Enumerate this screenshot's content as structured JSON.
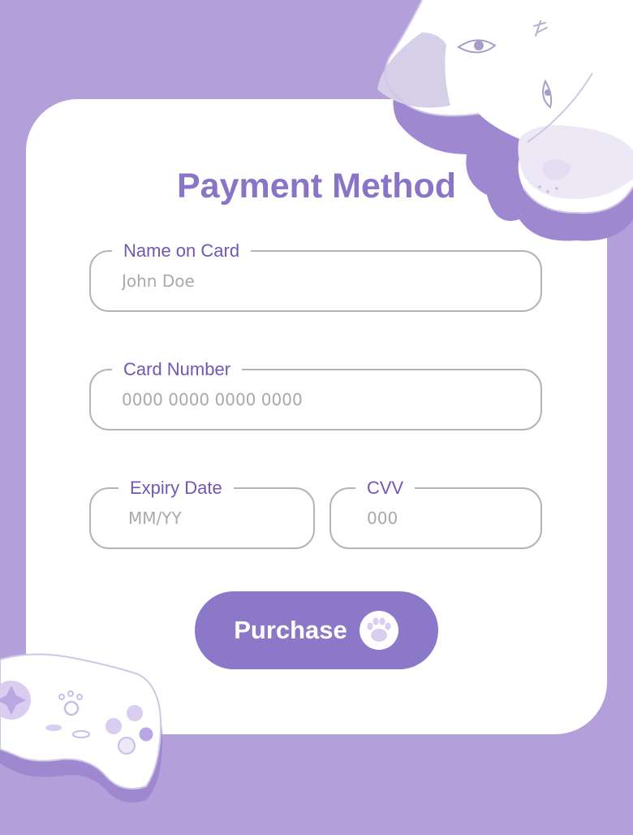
{
  "form": {
    "title": "Payment Method",
    "name_field": {
      "label": "Name on Card",
      "placeholder": "John Doe"
    },
    "number_field": {
      "label": "Card Number",
      "placeholder": "0000 0000 0000 0000"
    },
    "expiry_field": {
      "label": "Expiry Date",
      "placeholder": "MM/YY"
    },
    "cvv_field": {
      "label": "CVV",
      "placeholder": "000"
    },
    "purchase_label": "Purchase"
  },
  "icons": {
    "purchase_icon": "paw-icon",
    "top_right_decoration": "dog-illustration",
    "bottom_left_decoration": "game-controller-illustration"
  },
  "colors": {
    "background": "#b3a0da",
    "card": "#ffffff",
    "accent": "#8c78c8",
    "title": "#8a74c6",
    "label": "#6f58b4",
    "border": "#b4b4b4",
    "placeholder": "#a9a9a9"
  }
}
